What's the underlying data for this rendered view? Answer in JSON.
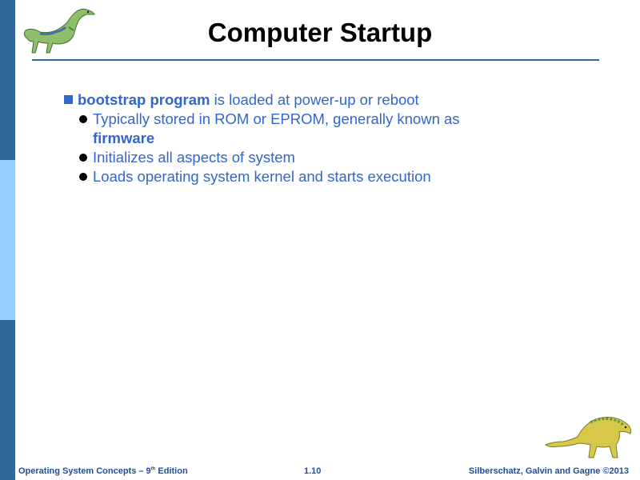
{
  "slide": {
    "title": "Computer Startup",
    "bullets": {
      "b1_keyword": "bootstrap program",
      "b1_rest": " is loaded at power-up or reboot",
      "b1a_text": "Typically stored in ROM or EPROM, generally known as",
      "b1a_keyword": "firmware",
      "b1b_text": "Initializes all aspects of system",
      "b1c_text": "Loads operating system kernel and starts execution"
    }
  },
  "footer": {
    "book_prefix": "Operating System Concepts – 9",
    "book_sup": "th",
    "book_suffix": " Edition",
    "page": "1.10",
    "authors": "Silberschatz, Galvin and Gagne ©2013"
  },
  "colors": {
    "sidebar_dark": "#336699",
    "sidebar_light": "#99ccff",
    "text_blue": "#3366cc",
    "footer_blue": "#1f4e99"
  },
  "icons": {
    "top_left": "dinosaur-icon",
    "bottom_right": "dinosaur-icon"
  }
}
